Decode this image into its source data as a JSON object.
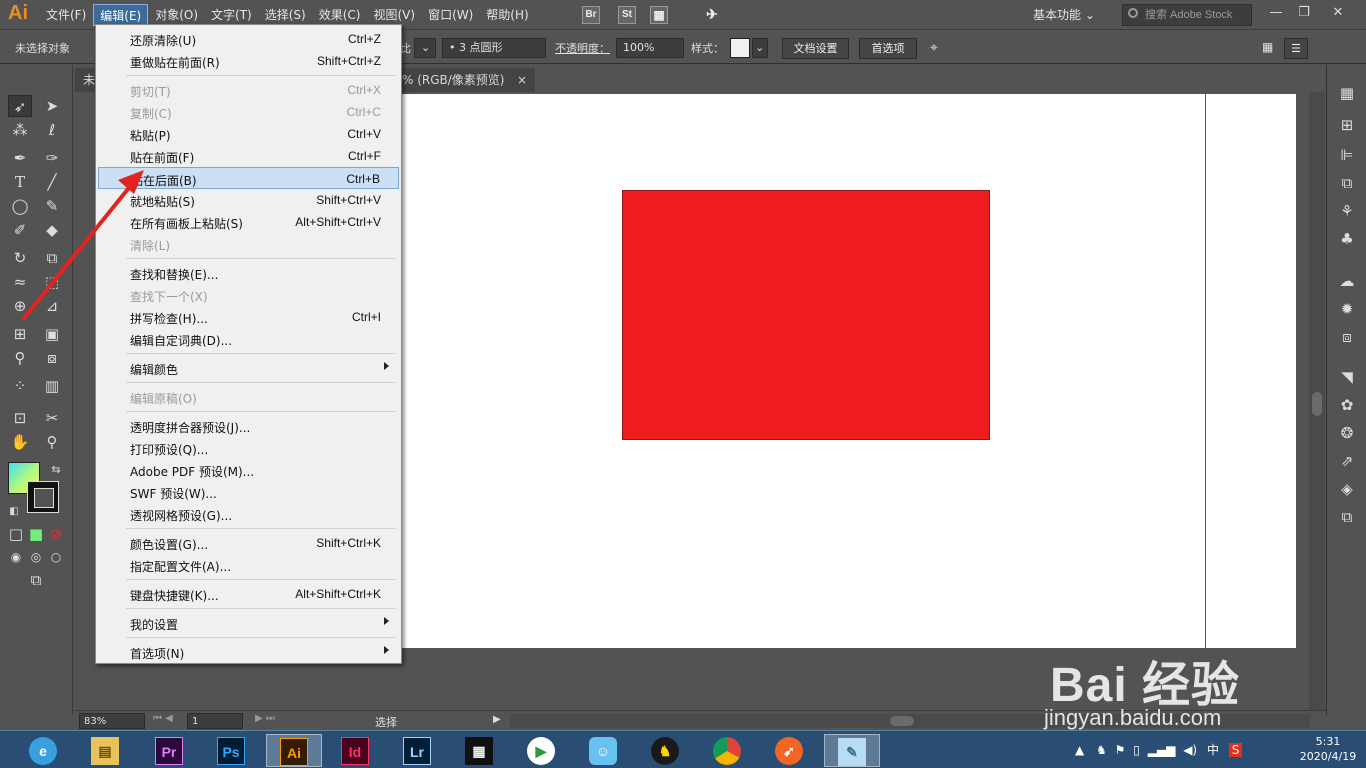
{
  "app": {
    "logo": "Ai",
    "menus": [
      "文件(F)",
      "编辑(E)",
      "对象(O)",
      "文字(T)",
      "选择(S)",
      "效果(C)",
      "视图(V)",
      "窗口(W)",
      "帮助(H)"
    ],
    "bridge_icon": "Br",
    "stock_icon": "St",
    "workspace": "基本功能",
    "search_placeholder": "搜索 Adobe Stock"
  },
  "control_bar": {
    "selection_status": "未选择对象",
    "ratio_label": "比",
    "brush": "3 点圆形",
    "opacity_label": "不透明度：",
    "opacity_value": "100%",
    "style_label": "样式：",
    "doc_setup": "文档设置",
    "preferences": "首选项"
  },
  "document": {
    "tab_prefix": "未",
    "tab_title": "% (RGB/像素预览)",
    "tab_close": "×",
    "shape_color": "#ee1c1f"
  },
  "edit_menu": {
    "items": [
      {
        "label": "还原清除(U)",
        "shortcut": "Ctrl+Z"
      },
      {
        "label": "重做贴在前面(R)",
        "shortcut": "Shift+Ctrl+Z"
      },
      {
        "label": "剪切(T)",
        "shortcut": "Ctrl+X"
      },
      {
        "label": "复制(C)",
        "shortcut": "Ctrl+C"
      },
      {
        "label": "粘贴(P)",
        "shortcut": "Ctrl+V"
      },
      {
        "label": "贴在前面(F)",
        "shortcut": "Ctrl+F"
      },
      {
        "label": "贴在后面(B)",
        "shortcut": "Ctrl+B"
      },
      {
        "label": "就地粘贴(S)",
        "shortcut": "Shift+Ctrl+V"
      },
      {
        "label": "在所有画板上粘贴(S)",
        "shortcut": "Alt+Shift+Ctrl+V"
      },
      {
        "label": "清除(L)",
        "shortcut": ""
      },
      {
        "label": "查找和替换(E)...",
        "shortcut": ""
      },
      {
        "label": "查找下一个(X)",
        "shortcut": ""
      },
      {
        "label": "拼写检查(H)...",
        "shortcut": "Ctrl+I"
      },
      {
        "label": "编辑自定词典(D)...",
        "shortcut": ""
      },
      {
        "label": "编辑颜色",
        "shortcut": ""
      },
      {
        "label": "编辑原稿(O)",
        "shortcut": ""
      },
      {
        "label": "透明度拼合器预设(J)...",
        "shortcut": ""
      },
      {
        "label": "打印预设(Q)...",
        "shortcut": ""
      },
      {
        "label": "Adobe PDF 预设(M)...",
        "shortcut": ""
      },
      {
        "label": "SWF 预设(W)...",
        "shortcut": ""
      },
      {
        "label": "透视网格预设(G)...",
        "shortcut": ""
      },
      {
        "label": "颜色设置(G)...",
        "shortcut": "Shift+Ctrl+K"
      },
      {
        "label": "指定配置文件(A)...",
        "shortcut": ""
      },
      {
        "label": "键盘快捷键(K)...",
        "shortcut": "Alt+Shift+Ctrl+K"
      },
      {
        "label": "我的设置",
        "shortcut": ""
      },
      {
        "label": "首选项(N)",
        "shortcut": ""
      }
    ]
  },
  "status_bar": {
    "zoom": "83%",
    "page": "1",
    "status": "选择"
  },
  "watermark": {
    "main": "Bai 经验",
    "sub": "jingyan.baidu.com"
  },
  "taskbar": {
    "apps": [
      "Pr",
      "Ps",
      "Ai",
      "Id",
      "Lr"
    ],
    "ime": "中",
    "time": "5:31",
    "date": "2020/4/19"
  }
}
